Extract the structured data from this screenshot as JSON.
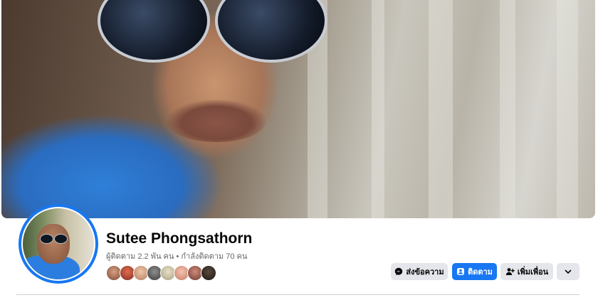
{
  "profile": {
    "name": "Sutee Phongsathorn",
    "stats": "ผู้ติดตาม 2.2 พัน คน • กำลังติดตาม 70 คน"
  },
  "friends_preview": [
    "friend-avatar-1",
    "friend-avatar-2",
    "friend-avatar-3",
    "friend-avatar-4",
    "friend-avatar-5",
    "friend-avatar-6",
    "friend-avatar-7",
    "friend-avatar-8"
  ],
  "actions": {
    "message_label": "ส่งข้อความ",
    "follow_label": "ติดตาม",
    "add_friend_label": "เพิ่มเพื่อน"
  },
  "icons": {
    "message": "messenger-icon",
    "follow": "follow-icon",
    "add_friend": "add-friend-icon",
    "more": "chevron-down-icon"
  },
  "colors": {
    "accent": "#1877f2",
    "button_gray": "#e4e6eb",
    "secondary_text": "#65676b"
  }
}
